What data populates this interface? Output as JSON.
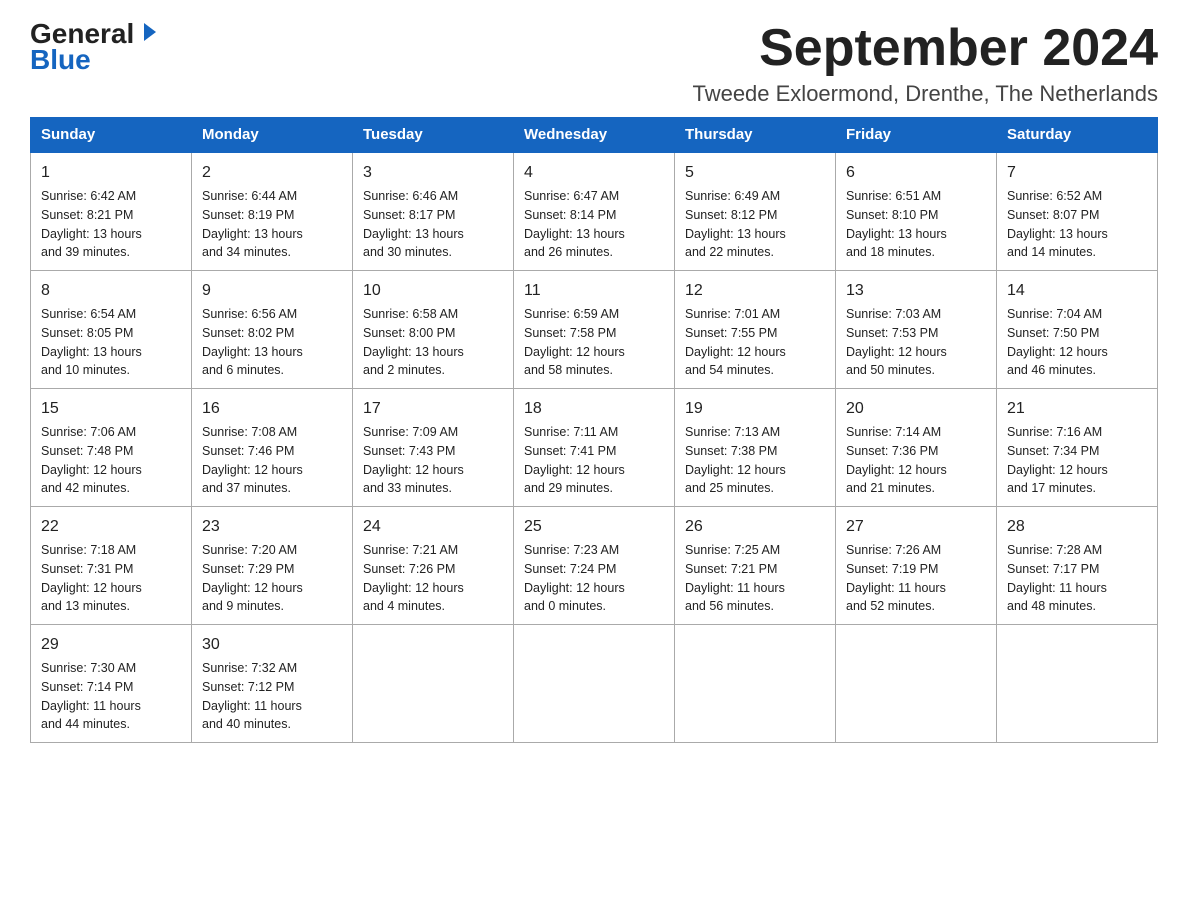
{
  "header": {
    "title": "September 2024",
    "subtitle": "Tweede Exloermond, Drenthe, The Netherlands",
    "logo_general": "General",
    "logo_blue": "Blue"
  },
  "columns": [
    "Sunday",
    "Monday",
    "Tuesday",
    "Wednesday",
    "Thursday",
    "Friday",
    "Saturday"
  ],
  "weeks": [
    [
      {
        "day": "1",
        "info": "Sunrise: 6:42 AM\nSunset: 8:21 PM\nDaylight: 13 hours\nand 39 minutes."
      },
      {
        "day": "2",
        "info": "Sunrise: 6:44 AM\nSunset: 8:19 PM\nDaylight: 13 hours\nand 34 minutes."
      },
      {
        "day": "3",
        "info": "Sunrise: 6:46 AM\nSunset: 8:17 PM\nDaylight: 13 hours\nand 30 minutes."
      },
      {
        "day": "4",
        "info": "Sunrise: 6:47 AM\nSunset: 8:14 PM\nDaylight: 13 hours\nand 26 minutes."
      },
      {
        "day": "5",
        "info": "Sunrise: 6:49 AM\nSunset: 8:12 PM\nDaylight: 13 hours\nand 22 minutes."
      },
      {
        "day": "6",
        "info": "Sunrise: 6:51 AM\nSunset: 8:10 PM\nDaylight: 13 hours\nand 18 minutes."
      },
      {
        "day": "7",
        "info": "Sunrise: 6:52 AM\nSunset: 8:07 PM\nDaylight: 13 hours\nand 14 minutes."
      }
    ],
    [
      {
        "day": "8",
        "info": "Sunrise: 6:54 AM\nSunset: 8:05 PM\nDaylight: 13 hours\nand 10 minutes."
      },
      {
        "day": "9",
        "info": "Sunrise: 6:56 AM\nSunset: 8:02 PM\nDaylight: 13 hours\nand 6 minutes."
      },
      {
        "day": "10",
        "info": "Sunrise: 6:58 AM\nSunset: 8:00 PM\nDaylight: 13 hours\nand 2 minutes."
      },
      {
        "day": "11",
        "info": "Sunrise: 6:59 AM\nSunset: 7:58 PM\nDaylight: 12 hours\nand 58 minutes."
      },
      {
        "day": "12",
        "info": "Sunrise: 7:01 AM\nSunset: 7:55 PM\nDaylight: 12 hours\nand 54 minutes."
      },
      {
        "day": "13",
        "info": "Sunrise: 7:03 AM\nSunset: 7:53 PM\nDaylight: 12 hours\nand 50 minutes."
      },
      {
        "day": "14",
        "info": "Sunrise: 7:04 AM\nSunset: 7:50 PM\nDaylight: 12 hours\nand 46 minutes."
      }
    ],
    [
      {
        "day": "15",
        "info": "Sunrise: 7:06 AM\nSunset: 7:48 PM\nDaylight: 12 hours\nand 42 minutes."
      },
      {
        "day": "16",
        "info": "Sunrise: 7:08 AM\nSunset: 7:46 PM\nDaylight: 12 hours\nand 37 minutes."
      },
      {
        "day": "17",
        "info": "Sunrise: 7:09 AM\nSunset: 7:43 PM\nDaylight: 12 hours\nand 33 minutes."
      },
      {
        "day": "18",
        "info": "Sunrise: 7:11 AM\nSunset: 7:41 PM\nDaylight: 12 hours\nand 29 minutes."
      },
      {
        "day": "19",
        "info": "Sunrise: 7:13 AM\nSunset: 7:38 PM\nDaylight: 12 hours\nand 25 minutes."
      },
      {
        "day": "20",
        "info": "Sunrise: 7:14 AM\nSunset: 7:36 PM\nDaylight: 12 hours\nand 21 minutes."
      },
      {
        "day": "21",
        "info": "Sunrise: 7:16 AM\nSunset: 7:34 PM\nDaylight: 12 hours\nand 17 minutes."
      }
    ],
    [
      {
        "day": "22",
        "info": "Sunrise: 7:18 AM\nSunset: 7:31 PM\nDaylight: 12 hours\nand 13 minutes."
      },
      {
        "day": "23",
        "info": "Sunrise: 7:20 AM\nSunset: 7:29 PM\nDaylight: 12 hours\nand 9 minutes."
      },
      {
        "day": "24",
        "info": "Sunrise: 7:21 AM\nSunset: 7:26 PM\nDaylight: 12 hours\nand 4 minutes."
      },
      {
        "day": "25",
        "info": "Sunrise: 7:23 AM\nSunset: 7:24 PM\nDaylight: 12 hours\nand 0 minutes."
      },
      {
        "day": "26",
        "info": "Sunrise: 7:25 AM\nSunset: 7:21 PM\nDaylight: 11 hours\nand 56 minutes."
      },
      {
        "day": "27",
        "info": "Sunrise: 7:26 AM\nSunset: 7:19 PM\nDaylight: 11 hours\nand 52 minutes."
      },
      {
        "day": "28",
        "info": "Sunrise: 7:28 AM\nSunset: 7:17 PM\nDaylight: 11 hours\nand 48 minutes."
      }
    ],
    [
      {
        "day": "29",
        "info": "Sunrise: 7:30 AM\nSunset: 7:14 PM\nDaylight: 11 hours\nand 44 minutes."
      },
      {
        "day": "30",
        "info": "Sunrise: 7:32 AM\nSunset: 7:12 PM\nDaylight: 11 hours\nand 40 minutes."
      },
      {
        "day": "",
        "info": ""
      },
      {
        "day": "",
        "info": ""
      },
      {
        "day": "",
        "info": ""
      },
      {
        "day": "",
        "info": ""
      },
      {
        "day": "",
        "info": ""
      }
    ]
  ]
}
